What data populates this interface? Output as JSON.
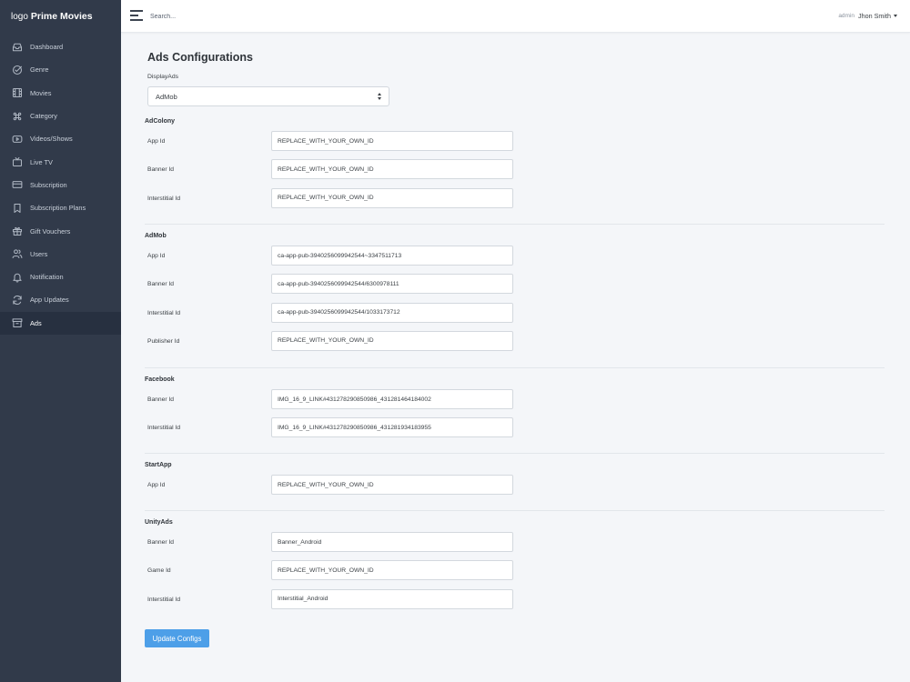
{
  "sidebar": {
    "logo_word": "logo",
    "brand": "Prime Movies",
    "items": [
      {
        "label": "Dashboard",
        "icon": "inbox-icon"
      },
      {
        "label": "Genre",
        "icon": "check-circle-icon"
      },
      {
        "label": "Movies",
        "icon": "film-icon"
      },
      {
        "label": "Category",
        "icon": "command-icon"
      },
      {
        "label": "Videos/Shows",
        "icon": "youtube-icon"
      },
      {
        "label": "Live TV",
        "icon": "tv-icon"
      },
      {
        "label": "Subscription",
        "icon": "credit-card-icon"
      },
      {
        "label": "Subscription Plans",
        "icon": "bookmark-icon"
      },
      {
        "label": "Gift Vouchers",
        "icon": "gift-icon"
      },
      {
        "label": "Users",
        "icon": "users-icon"
      },
      {
        "label": "Notification",
        "icon": "bell-icon"
      },
      {
        "label": "App Updates",
        "icon": "refresh-icon"
      },
      {
        "label": "Ads",
        "icon": "archive-icon",
        "active": true
      }
    ]
  },
  "topbar": {
    "search_placeholder": "Search...",
    "role": "admin",
    "username": "Jhon Smith"
  },
  "page": {
    "title": "Ads Configurations",
    "display_label": "DisplayAds",
    "display_value": "AdMob",
    "update_button": "Update Configs"
  },
  "sections": [
    {
      "title": "AdColony",
      "fields": [
        {
          "label": "App Id",
          "value": "REPLACE_WITH_YOUR_OWN_ID"
        },
        {
          "label": "Banner Id",
          "value": "REPLACE_WITH_YOUR_OWN_ID"
        },
        {
          "label": "Interstitial Id",
          "value": "REPLACE_WITH_YOUR_OWN_ID"
        }
      ]
    },
    {
      "title": "AdMob",
      "fields": [
        {
          "label": "App Id",
          "value": "ca-app-pub-3940256099942544~3347511713"
        },
        {
          "label": "Banner Id",
          "value": "ca-app-pub-3940256099942544/6300978111"
        },
        {
          "label": "Interstitial Id",
          "value": "ca-app-pub-3940256099942544/1033173712"
        },
        {
          "label": "Publisher Id",
          "value": "REPLACE_WITH_YOUR_OWN_ID"
        }
      ]
    },
    {
      "title": "Facebook",
      "fields": [
        {
          "label": "Banner Id",
          "value": "IMG_16_9_LINK#431278290850986_431281464184002"
        },
        {
          "label": "Interstitial Id",
          "value": "IMG_16_9_LINK#431278290850986_431281934183955"
        }
      ]
    },
    {
      "title": "StartApp",
      "fields": [
        {
          "label": "App Id",
          "value": "REPLACE_WITH_YOUR_OWN_ID"
        }
      ]
    },
    {
      "title": "UnityAds",
      "fields": [
        {
          "label": "Banner Id",
          "value": "Banner_Android"
        },
        {
          "label": "Game Id",
          "value": "REPLACE_WITH_YOUR_OWN_ID"
        },
        {
          "label": "Interstitial Id",
          "value": "Interstitial_Android"
        }
      ]
    }
  ],
  "colors": {
    "sidebar_bg": "#313a4a",
    "sidebar_active": "#273040",
    "page_bg": "#f4f6f9",
    "button_primary": "#4d9fe8"
  }
}
